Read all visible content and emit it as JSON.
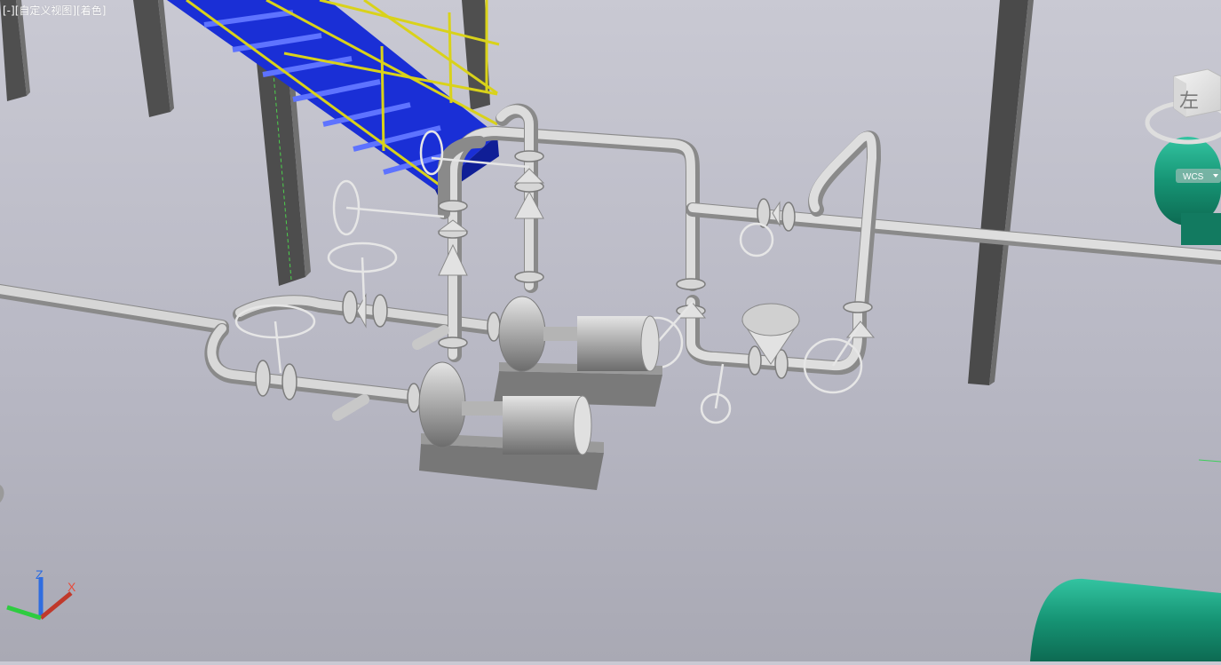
{
  "viewport": {
    "label_parts": {
      "minus": "[-]",
      "view": "[自定义视图]",
      "style": "[着色]"
    }
  },
  "viewcube": {
    "face_label": "左",
    "wcs_label": "WCS"
  },
  "ucs_icon": {
    "z_label": "Z",
    "x_label": "X"
  },
  "colors": {
    "background_top": "#c9c9d3",
    "background_bottom": "#a9a9b4",
    "pipe": "#c8c8c8",
    "steel": "#555555",
    "stair": "#1a2fd6",
    "rail": "#d9d21a",
    "tank": "#1a9a7e",
    "axis_x": "#c0392b",
    "axis_y": "#2ecc40",
    "axis_z": "#2f6de0"
  },
  "icons": [
    "viewcube",
    "ucs-axis-icon",
    "wcs-dropdown-icon"
  ]
}
